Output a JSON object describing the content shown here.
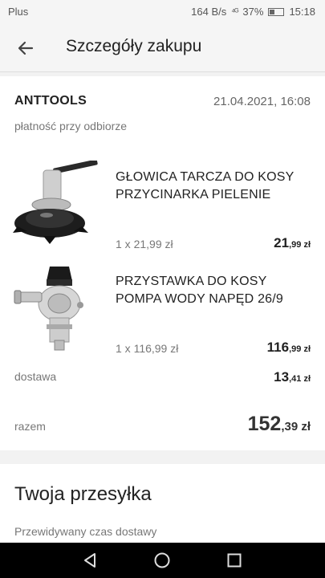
{
  "status_bar": {
    "carrier": "Plus",
    "speed": "164 B/s",
    "signal": "⁴ᴳ",
    "battery": "37%",
    "time": "15:18"
  },
  "app_bar": {
    "title": "Szczegóły zakupu"
  },
  "order": {
    "seller": "ANTTOOLS",
    "date": "21.04.2021, 16:08",
    "payment": "płatność przy odbiorze",
    "items": [
      {
        "name": "GŁOWICA TARCZA DO KOSY PRZYCINARKA PIELENIE",
        "quantity": "1 x 21,99 zł",
        "price_int": "21",
        "price_dec": ",99 zł"
      },
      {
        "name": "PRZYSTAWKA DO KOSY POMPA WODY NAPĘD 26/9",
        "quantity": "1 x 116,99 zł",
        "price_int": "116",
        "price_dec": ",99 zł"
      }
    ],
    "delivery_label": "dostawa",
    "delivery_int": "13",
    "delivery_dec": ",41 zł",
    "total_label": "razem",
    "total_int": "152",
    "total_dec": ",39 zł"
  },
  "shipment": {
    "heading": "Twoja przesyłka",
    "subheading": "Przewidywany czas dostawy"
  }
}
